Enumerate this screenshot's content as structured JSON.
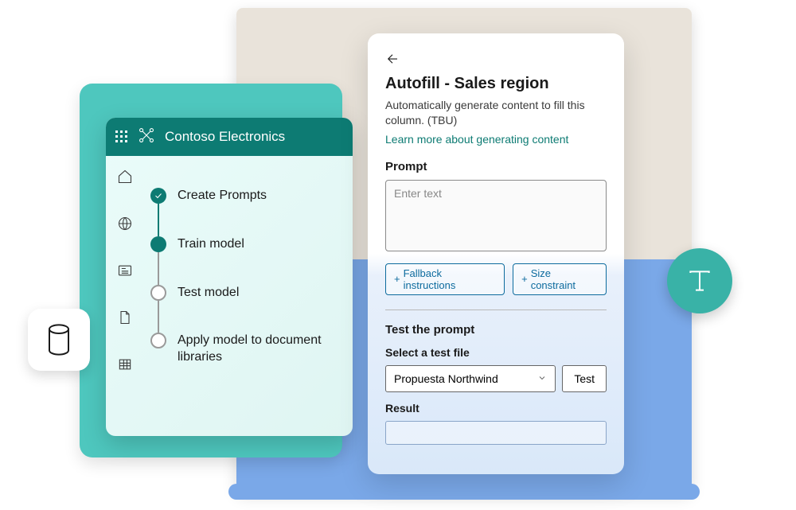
{
  "contoso": {
    "title": "Contoso Electronics",
    "nav_icons": [
      "home",
      "globe",
      "news",
      "file",
      "table"
    ],
    "steps": [
      {
        "label": "Create Prompts",
        "state": "done"
      },
      {
        "label": "Train model",
        "state": "active"
      },
      {
        "label": "Test model",
        "state": "pending"
      },
      {
        "label": "Apply model to document libraries",
        "state": "pending"
      }
    ]
  },
  "autofill": {
    "title": "Autofill - Sales region",
    "description": "Automatically generate content to fill this column. (TBU)",
    "learn_more": "Learn more about generating content",
    "prompt_label": "Prompt",
    "prompt_placeholder": "Enter text",
    "pills": {
      "fallback": "Fallback instructions",
      "size": "Size constraint"
    },
    "test_heading": "Test the prompt",
    "select_label": "Select a test file",
    "select_value": "Propuesta Northwind",
    "test_button": "Test",
    "result_label": "Result"
  },
  "decorative": {
    "db_icon": "database-icon",
    "type_icon": "text-type-icon"
  }
}
